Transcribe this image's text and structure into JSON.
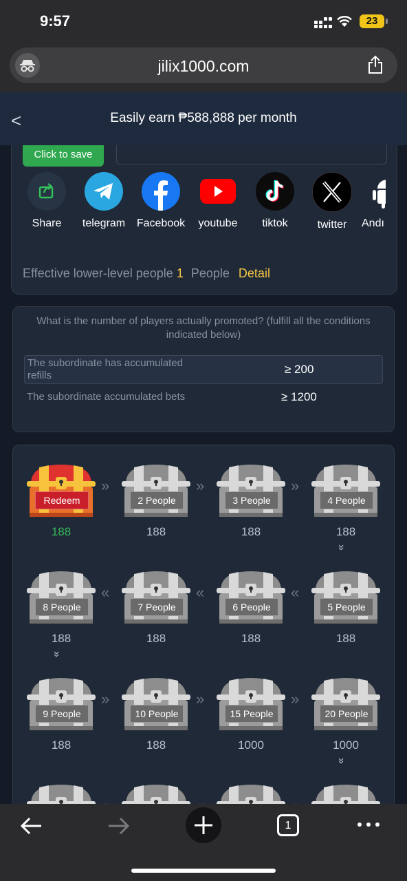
{
  "status_bar": {
    "time": "9:57",
    "battery": "23"
  },
  "browser": {
    "url": "jilix1000.com"
  },
  "header": {
    "back": "<",
    "title": "Easily earn ₱588,888 per month"
  },
  "share_card": {
    "save_label": "Click to save",
    "social": [
      {
        "label": "Share",
        "icon": "share-icon"
      },
      {
        "label": "telegram",
        "icon": "telegram-icon"
      },
      {
        "label": "Facebook",
        "icon": "facebook-icon"
      },
      {
        "label": "youtube",
        "icon": "youtube-icon"
      },
      {
        "label": "tiktok",
        "icon": "tiktok-icon"
      },
      {
        "label": "twitter",
        "icon": "x-icon"
      },
      {
        "label": "Andı",
        "icon": "android-icon"
      }
    ],
    "effective_label": "Effective lower-level people",
    "effective_count": "1",
    "people_unit": "People",
    "detail_label": "Detail"
  },
  "conditions": {
    "question": "What is the number of players actually promoted? (fulfill all the conditions indicated below)",
    "items": [
      {
        "label": "The subordinate has accumulated refills",
        "value": "≥ 200"
      },
      {
        "label": "The subordinate accumulated bets",
        "value": "≥ 1200"
      }
    ]
  },
  "chests": [
    {
      "label": "Redeem",
      "value": "188"
    },
    {
      "label": "2 People",
      "value": "188"
    },
    {
      "label": "3 People",
      "value": "188"
    },
    {
      "label": "4 People",
      "value": "188"
    },
    {
      "label": "8 People",
      "value": "188"
    },
    {
      "label": "7 People",
      "value": "188"
    },
    {
      "label": "6 People",
      "value": "188"
    },
    {
      "label": "5 People",
      "value": "188"
    },
    {
      "label": "9 People",
      "value": "188"
    },
    {
      "label": "10 People",
      "value": "188"
    },
    {
      "label": "15 People",
      "value": "1000"
    },
    {
      "label": "20 People",
      "value": "1000"
    }
  ],
  "toolbar": {
    "tab_count": "1"
  },
  "colors": {
    "accent_yellow": "#f5c542",
    "green": "#2fa84f",
    "redeem_red": "#c81f2b"
  }
}
